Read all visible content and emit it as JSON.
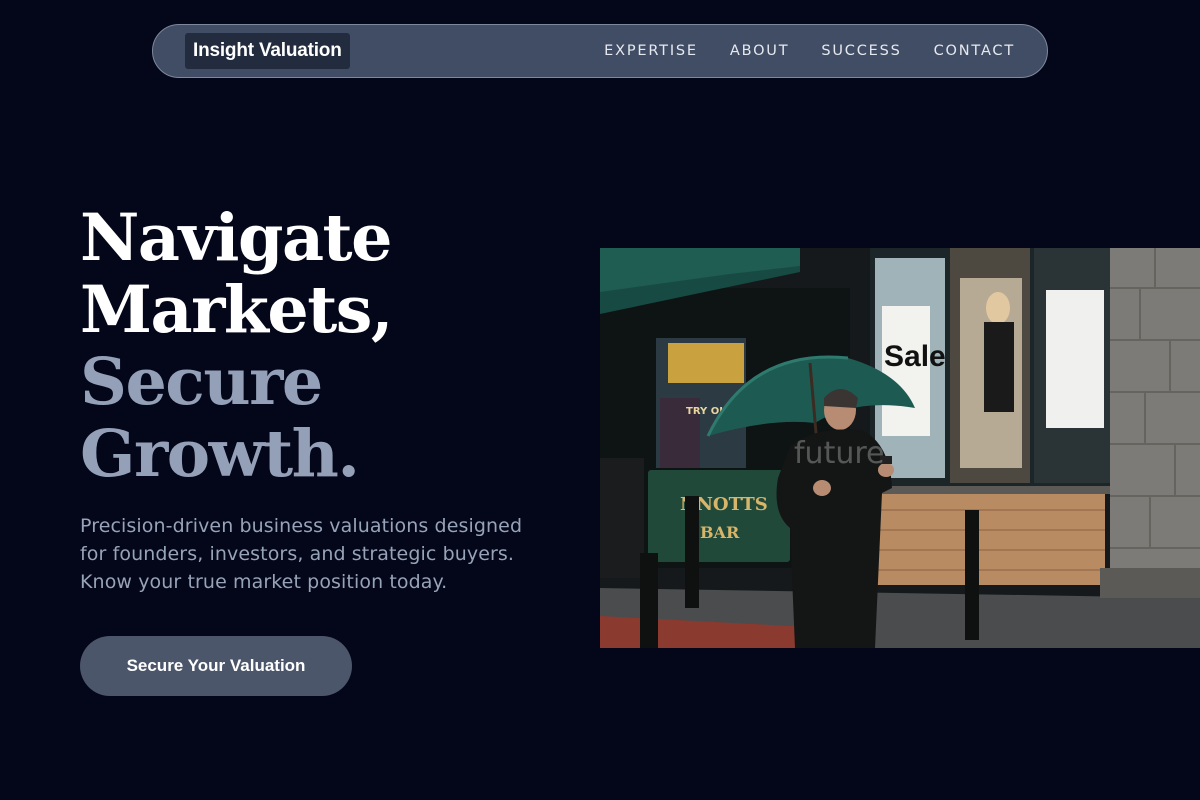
{
  "nav": {
    "logo": "Insight Valuation",
    "links": [
      "EXPERTISE",
      "ABOUT",
      "SUCCESS",
      "CONTACT"
    ]
  },
  "hero": {
    "title_lines": [
      "Navigate",
      "Markets,",
      "Secure",
      "Growth."
    ],
    "subtitle_lines": [
      "Precision-driven business valuations designed",
      "for founders, investors, and strategic buyers.",
      "Know your true market position today."
    ],
    "cta_label": "Secure Your Valuation"
  },
  "photo": {
    "sign_sale": "Sale",
    "sign_bar": "BAR",
    "sign_nnotts": "NNOTTS",
    "sign_try": "TRY OUR",
    "watermark": "future"
  },
  "colors": {
    "background": "#04061a",
    "nav_bg": "#414d64",
    "accent_muted": "#94a0b8",
    "cta_bg": "#4b566b"
  }
}
